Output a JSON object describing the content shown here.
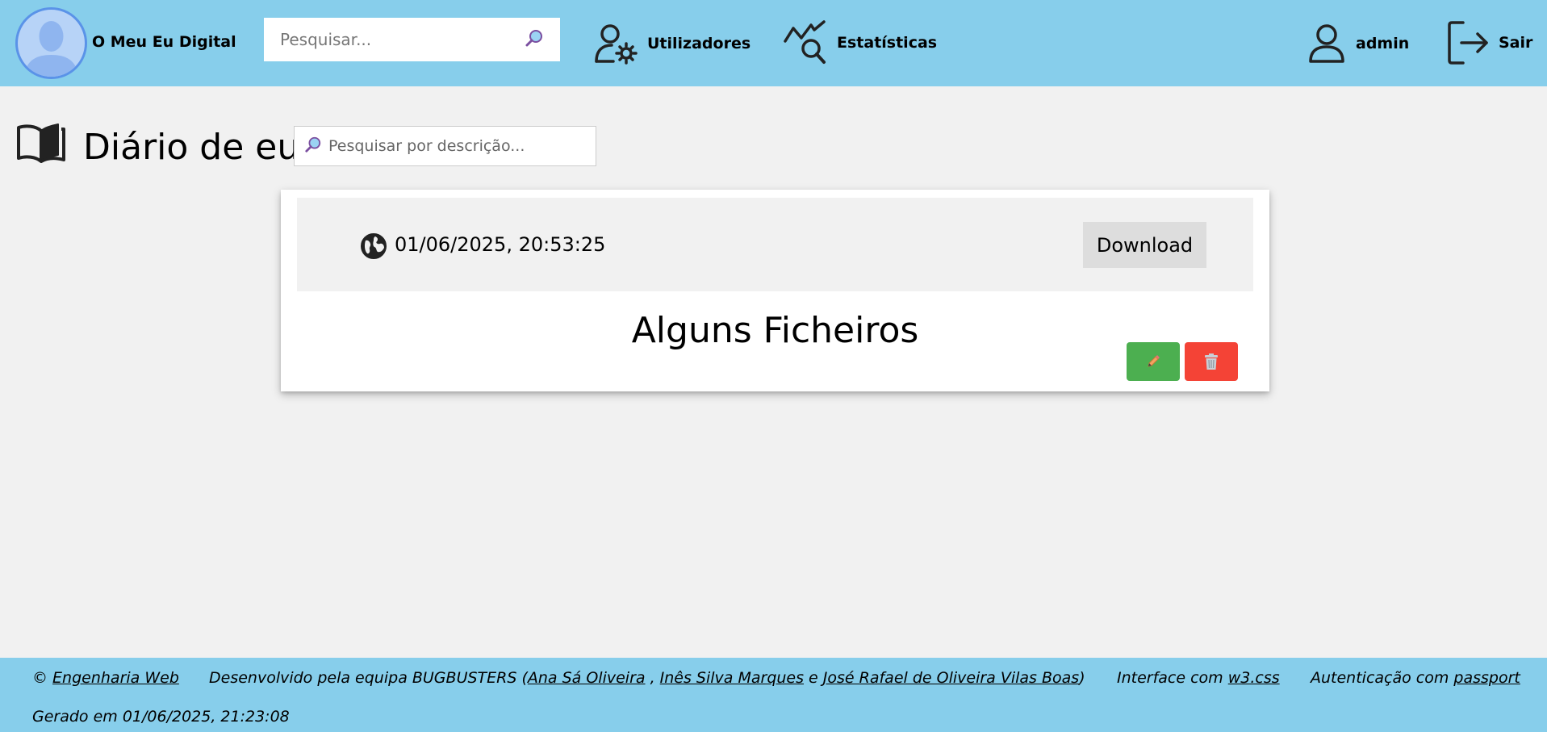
{
  "navbar": {
    "brand": "O Meu Eu Digital",
    "search_placeholder": "Pesquisar...",
    "users_label": "Utilizadores",
    "stats_label": "Estatísticas",
    "username": "admin",
    "logout_label": "Sair",
    "background_color": "#87ceeb"
  },
  "page": {
    "title": "Diário de eu",
    "search_placeholder": "Pesquisar por descrição..."
  },
  "entry": {
    "visibility_icon": "globe-icon",
    "datetime": "01/06/2025, 20:53:25",
    "download_label": "Download",
    "title": "Alguns Ficheiros",
    "edit_icon": "pencil-icon",
    "delete_icon": "trash-icon",
    "edit_color": "#4caf50",
    "delete_color": "#f44336"
  },
  "footer": {
    "copyright_symbol": "©",
    "course_link": "Engenharia Web",
    "developed_prefix": "Desenvolvido pela equipa BUGBUSTERS (",
    "dev1": "Ana Sá Oliveira",
    "sep1": " , ",
    "dev2": "Inês Silva Marques",
    "sep2": " e ",
    "dev3": "José Rafael de Oliveira Vilas Boas",
    "developed_suffix": ")",
    "interface_prefix": "Interface com ",
    "interface_link": "w3.css",
    "auth_prefix": "Autenticação com ",
    "auth_link": "passport",
    "generated": "Gerado em 01/06/2025, 21:23:08"
  }
}
